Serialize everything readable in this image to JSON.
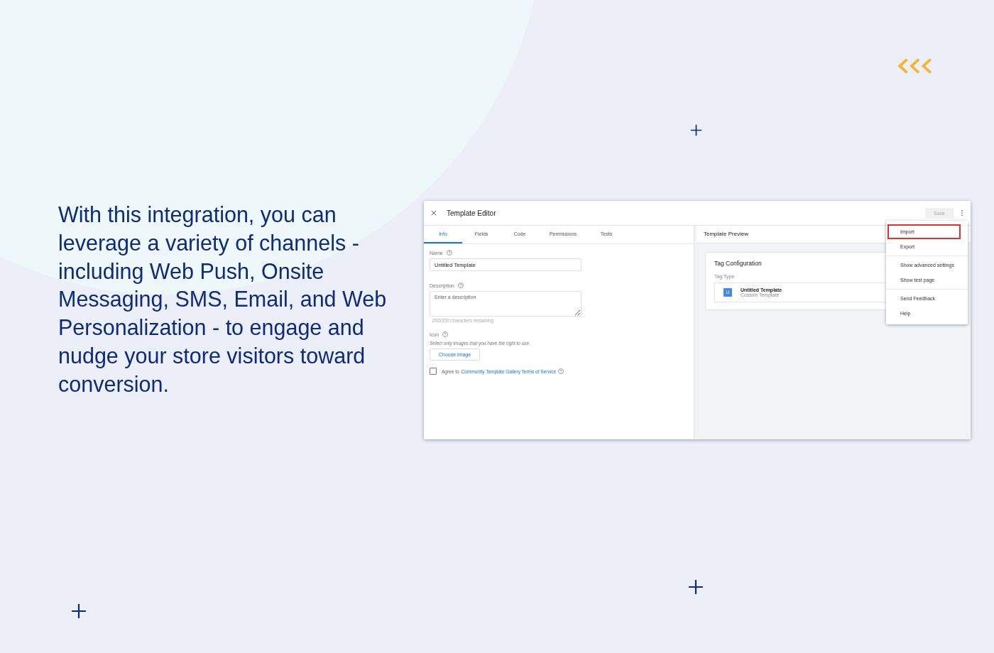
{
  "headline": "With this integration, you can leverage a variety of channels - including Web Push, Onsite Messaging, SMS, Email, and Web Personalization - to engage and nudge your store visitors toward conversion.",
  "window": {
    "title": "Template Editor",
    "save_label": "Save"
  },
  "tabs": [
    {
      "label": "Info",
      "selected": true
    },
    {
      "label": "Fields",
      "selected": false
    },
    {
      "label": "Code",
      "selected": false
    },
    {
      "label": "Permissions",
      "selected": false
    },
    {
      "label": "Tests",
      "selected": false
    }
  ],
  "form": {
    "name_label": "Name",
    "name_value": "Untitled Template",
    "description_label": "Description",
    "description_placeholder": "Enter a description",
    "description_hint": "200/200 characters remaining",
    "icon_label": "Icon",
    "icon_hint": "Select only images that you have the right to use",
    "choose_button": "Choose image",
    "agree_text": "Agree to",
    "agree_link": "Community Template Gallery Terms of Service",
    "agree_checked": false
  },
  "preview": {
    "title": "Template Preview",
    "card_title": "Tag Configuration",
    "tag_type_label": "Tag Type",
    "tag_letter": "U",
    "tag_name": "Untitled Template",
    "tag_subtitle": "Custom Template"
  },
  "menu": [
    [
      {
        "label": "Import",
        "highlighted": true
      },
      {
        "label": "Export",
        "highlighted": false
      }
    ],
    [
      {
        "label": "Show advanced settings",
        "highlighted": false
      },
      {
        "label": "Show test page",
        "highlighted": false
      }
    ],
    [
      {
        "label": "Send Feedback",
        "highlighted": false
      },
      {
        "label": "Help",
        "highlighted": false
      }
    ]
  ]
}
